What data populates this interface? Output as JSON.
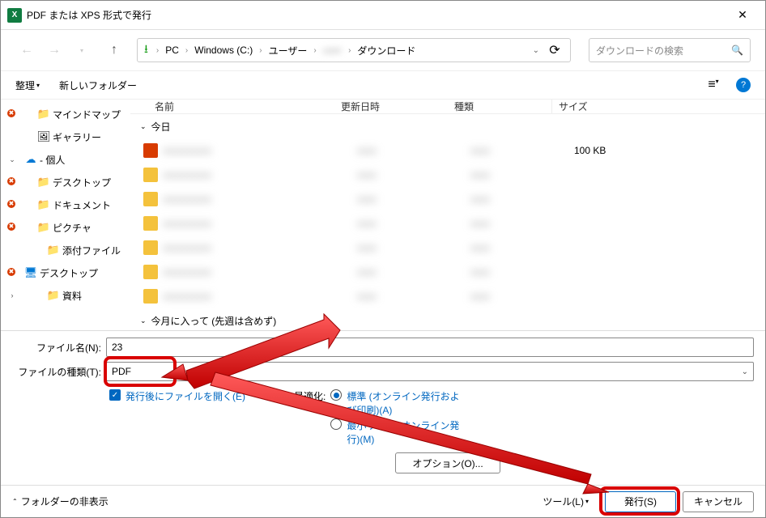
{
  "window": {
    "title": "PDF または XPS 形式で発行"
  },
  "nav": {
    "breadcrumb": [
      "PC",
      "Windows (C:)",
      "ユーザー",
      "",
      "ダウンロード"
    ],
    "search_placeholder": "ダウンロードの検索"
  },
  "toolbar": {
    "organize": "整理",
    "new_folder": "新しいフォルダー"
  },
  "sidebar": {
    "items": [
      {
        "label": "マインドマップ",
        "icon": "folder",
        "indent": 24,
        "sync": true
      },
      {
        "label": "ギャラリー",
        "icon": "image",
        "indent": 24
      },
      {
        "label": " ",
        "suffix": "- 個人",
        "icon": "cloud",
        "indent": 8,
        "exp": "v",
        "blur": true
      },
      {
        "label": "デスクトップ",
        "icon": "folder",
        "indent": 24,
        "sync": true,
        "exp": ">"
      },
      {
        "label": "ドキュメント",
        "icon": "folder",
        "indent": 24,
        "sync": true,
        "exp": ">"
      },
      {
        "label": "ピクチャ",
        "icon": "folder",
        "indent": 24,
        "sync": true,
        "exp": ">"
      },
      {
        "label": "添付ファイル",
        "icon": "folder",
        "indent": 36
      },
      {
        "label": "デスクトップ",
        "icon": "monitor",
        "indent": 8,
        "sync": true,
        "exp": "v"
      },
      {
        "label": "資料",
        "icon": "folder",
        "indent": 36,
        "exp": ">"
      }
    ]
  },
  "filelist": {
    "headers": {
      "name": "名前",
      "date": "更新日時",
      "type": "種類",
      "size": "サイズ"
    },
    "groups": [
      {
        "label": "今日",
        "rows": [
          {
            "icon": "red",
            "name": " ",
            "date": " ",
            "type": " ",
            "size": "100 KB"
          },
          {
            "icon": "yel",
            "name": " ",
            "date": " ",
            "type": " ",
            "size": ""
          },
          {
            "icon": "yel",
            "name": " ",
            "date": " ",
            "type": " ",
            "size": ""
          },
          {
            "icon": "yel",
            "name": " ",
            "date": " ",
            "type": " ",
            "size": ""
          },
          {
            "icon": "yel",
            "name": " ",
            "date": " ",
            "type": " ",
            "size": ""
          },
          {
            "icon": "yel",
            "name": " ",
            "date": " ",
            "type": " ",
            "size": ""
          },
          {
            "icon": "yel",
            "name": " ",
            "date": " ",
            "type": " ",
            "size": ""
          }
        ]
      },
      {
        "label": "今月に入って (先週は含めず)",
        "rows": []
      }
    ]
  },
  "form": {
    "filename_label": "ファイル名(N):",
    "filename_value": "23",
    "filetype_label": "ファイルの種類(T):",
    "filetype_value": "PDF",
    "open_after_label": "発行後にファイルを開く(E)",
    "optimize_label": "最適化:",
    "opt_standard": "標準 (オンライン発行および印刷)(A)",
    "opt_minimum": "最小サイズ (オンライン発行)(M)",
    "options_button": "オプション(O)..."
  },
  "footer": {
    "hide_folders": "フォルダーの非表示",
    "tools": "ツール(L)",
    "publish": "発行(S)",
    "cancel": "キャンセル"
  }
}
